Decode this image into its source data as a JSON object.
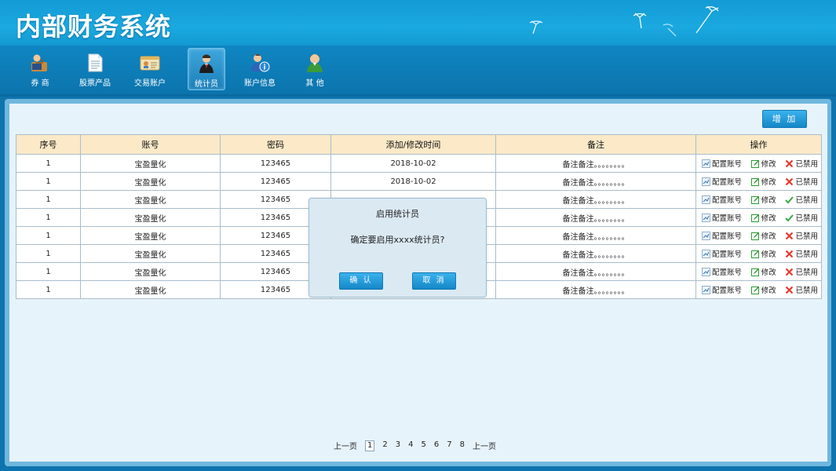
{
  "app": {
    "title": "内部财务系统"
  },
  "nav": [
    {
      "label": "券 商",
      "icon": "broker-icon"
    },
    {
      "label": "股票产品",
      "icon": "document-icon"
    },
    {
      "label": "交易账户",
      "icon": "id-card-icon"
    },
    {
      "label": "统计员",
      "icon": "statistician-icon",
      "active": true
    },
    {
      "label": "账户信息",
      "icon": "account-info-icon"
    },
    {
      "label": "其 他",
      "icon": "person-icon"
    }
  ],
  "toolbar": {
    "add_label": "增 加"
  },
  "table": {
    "headers": [
      "序号",
      "账号",
      "密码",
      "添加/修改时间",
      "备注",
      "操作"
    ],
    "rows": [
      {
        "id": "1",
        "account": "宝盈量化",
        "password": "123465",
        "time": "2018-10-02",
        "note": "备注备注。。。。。。。。",
        "status": "disabled"
      },
      {
        "id": "1",
        "account": "宝盈量化",
        "password": "123465",
        "time": "2018-10-02",
        "note": "备注备注。。。。。。。。",
        "status": "disabled"
      },
      {
        "id": "1",
        "account": "宝盈量化",
        "password": "123465",
        "time": "",
        "note": "备注备注。。。。。。。。",
        "status": "enabled"
      },
      {
        "id": "1",
        "account": "宝盈量化",
        "password": "123465",
        "time": "",
        "note": "备注备注。。。。。。。。",
        "status": "enabled"
      },
      {
        "id": "1",
        "account": "宝盈量化",
        "password": "123465",
        "time": "",
        "note": "备注备注。。。。。。。。",
        "status": "disabled"
      },
      {
        "id": "1",
        "account": "宝盈量化",
        "password": "123465",
        "time": "",
        "note": "备注备注。。。。。。。。",
        "status": "disabled"
      },
      {
        "id": "1",
        "account": "宝盈量化",
        "password": "123465",
        "time": "",
        "note": "备注备注。。。。。。。。",
        "status": "disabled"
      },
      {
        "id": "1",
        "account": "宝盈量化",
        "password": "123465",
        "time": "",
        "note": "备注备注。。。。。。。。",
        "status": "disabled"
      }
    ],
    "ops": {
      "config": "配置账号",
      "edit": "修改",
      "status_label": "已禁用"
    }
  },
  "modal": {
    "title": "启用统计员",
    "message": "确定要启用xxxx统计员?",
    "confirm": "确 认",
    "cancel": "取 消"
  },
  "pager": {
    "prev": "上一页",
    "pages": [
      "1",
      "2",
      "3",
      "4",
      "5",
      "6",
      "7",
      "8"
    ],
    "current": "1",
    "next": "上一页"
  },
  "colors": {
    "accent": "#1587c8",
    "header": "#1aa9e0",
    "table_header": "#fbe9c8",
    "disabled": "#e53a2f",
    "enabled": "#3aa845",
    "edit": "#2e9a34"
  }
}
